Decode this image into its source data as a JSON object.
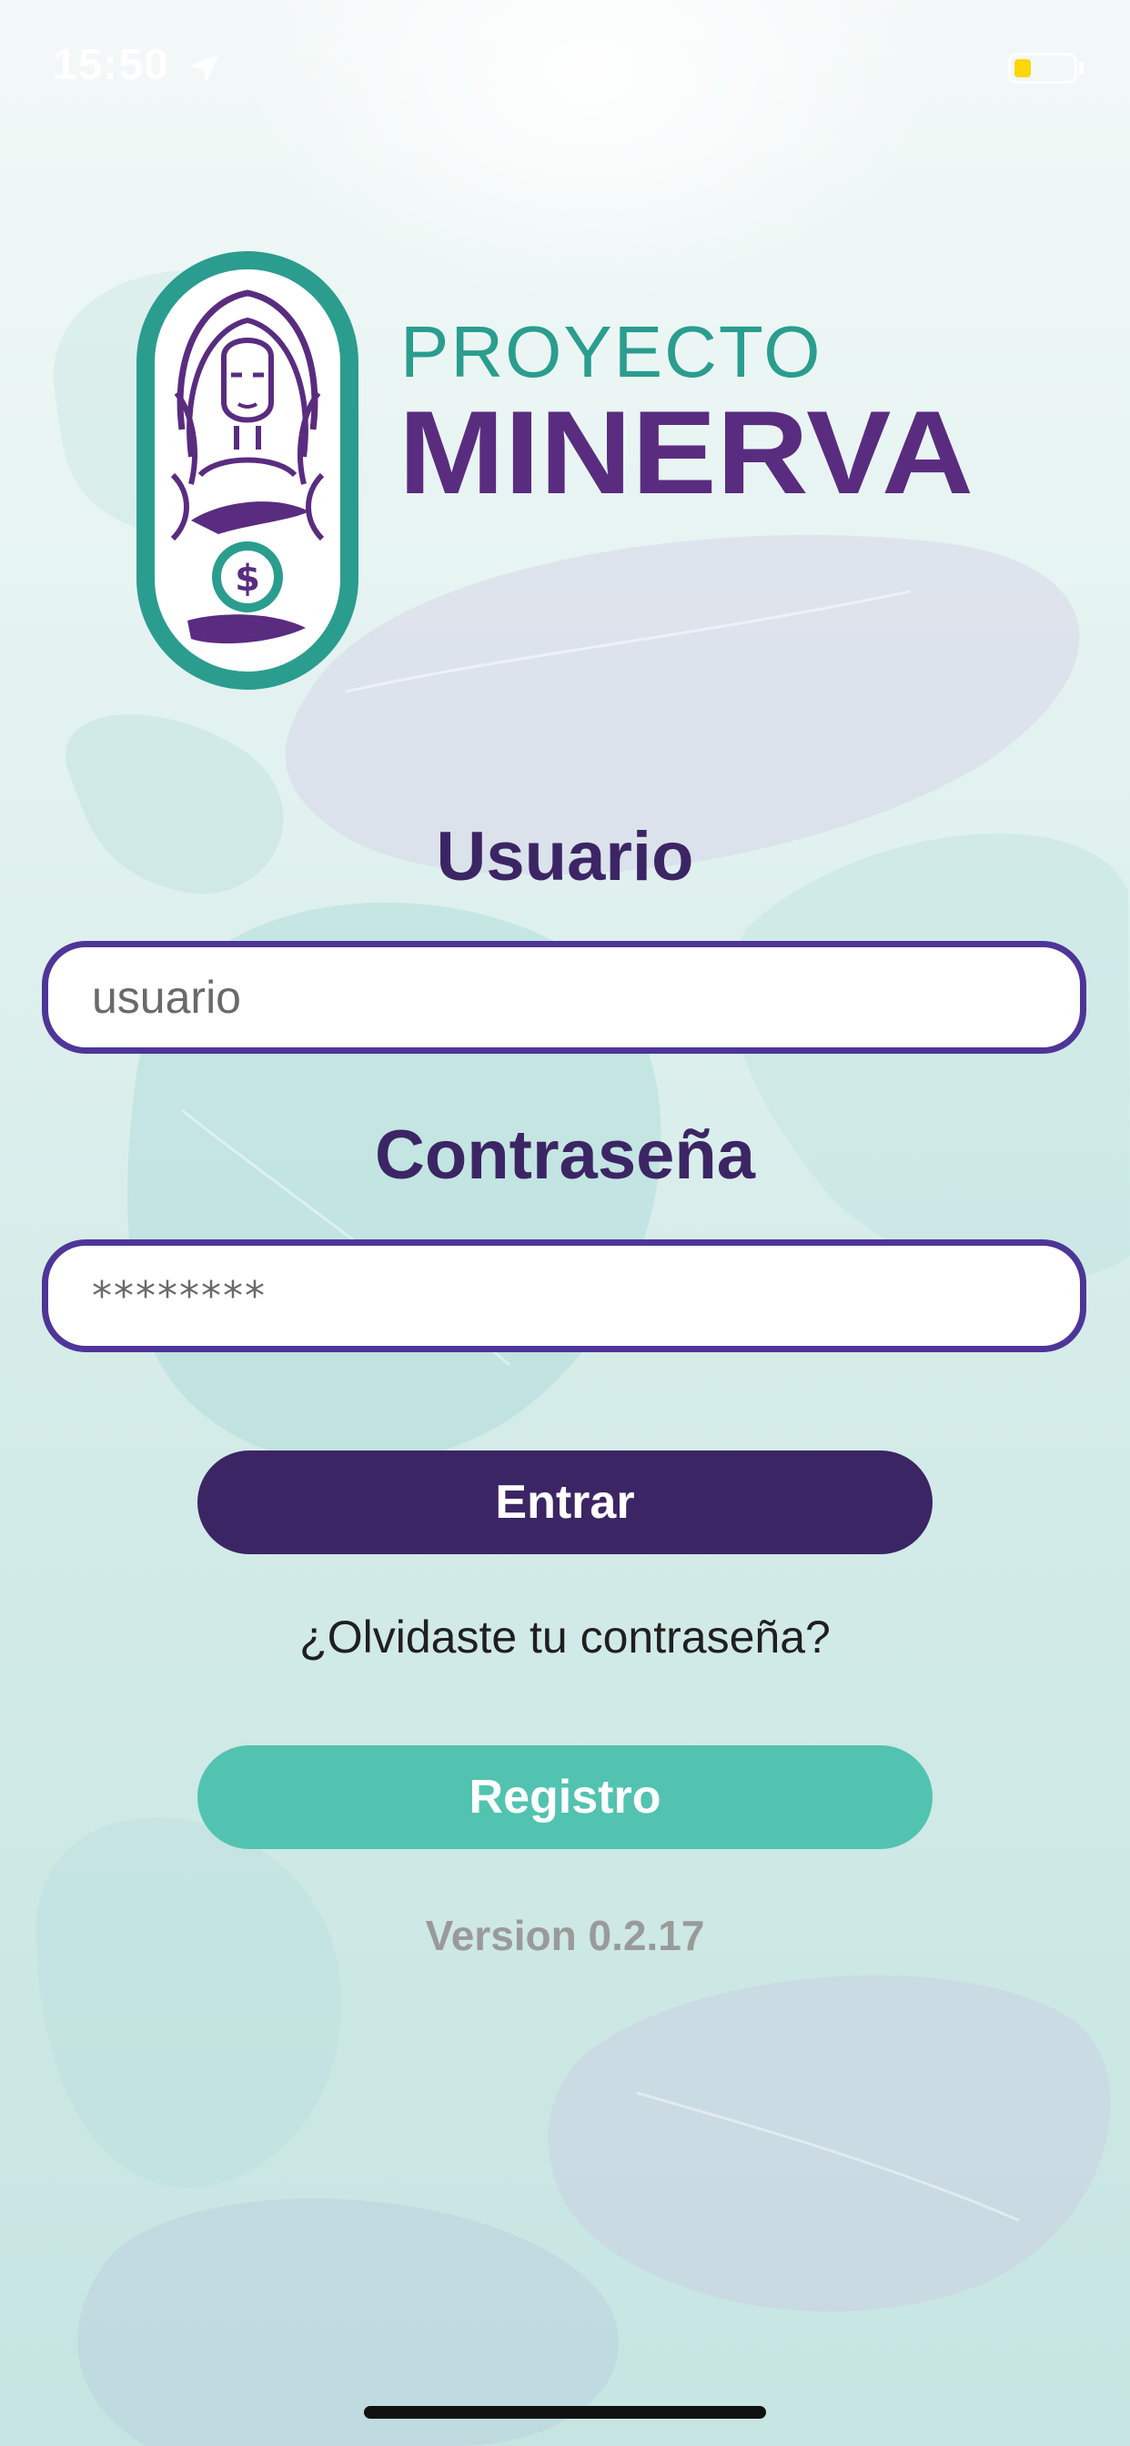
{
  "status_bar": {
    "time": "15:50",
    "location_icon": "location-arrow-icon",
    "battery_icon": "battery-low-icon",
    "battery_color": "#ffd60a"
  },
  "logo": {
    "line1": "PROYECTO",
    "line2": "MINERVA",
    "symbol": "$",
    "teal": "#2a9d8f",
    "purple": "#5a2c80"
  },
  "form": {
    "username_label": "Usuario",
    "username_placeholder": "usuario",
    "password_label": "Contraseña",
    "password_value": "********"
  },
  "buttons": {
    "login_label": "Entrar",
    "forgot_link": "¿Olvidaste tu contraseña?",
    "register_label": "Registro"
  },
  "footer": {
    "version": "Version 0.2.17"
  },
  "colors": {
    "primary": "#3c2564",
    "field_border": "#4e3598",
    "secondary": "#52c3b0",
    "version_text": "#9a9a9a"
  }
}
